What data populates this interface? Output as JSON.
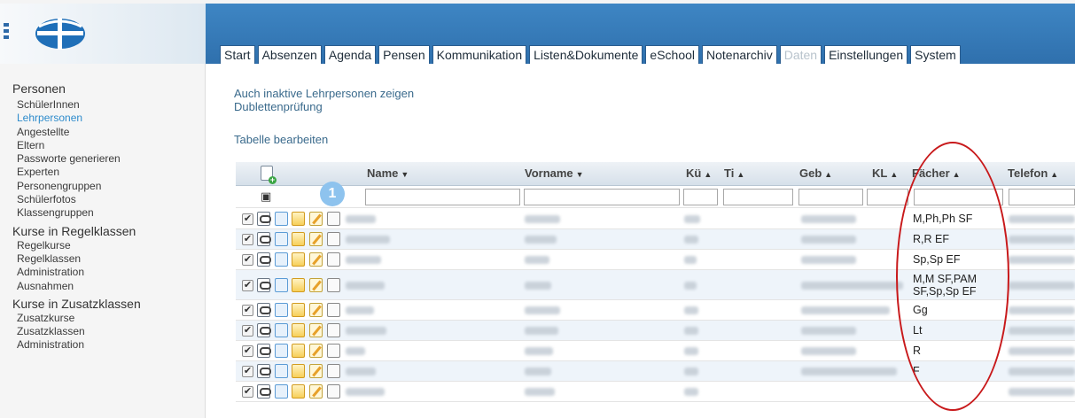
{
  "tabs": [
    {
      "label": "Start",
      "enabled": true
    },
    {
      "label": "Absenzen",
      "enabled": true
    },
    {
      "label": "Agenda",
      "enabled": true
    },
    {
      "label": "Pensen",
      "enabled": true
    },
    {
      "label": "Kommunikation",
      "enabled": true
    },
    {
      "label": "Listen&Dokumente",
      "enabled": true
    },
    {
      "label": "eSchool",
      "enabled": true
    },
    {
      "label": "Notenarchiv",
      "enabled": true
    },
    {
      "label": "Daten",
      "enabled": false
    },
    {
      "label": "Einstellungen",
      "enabled": true
    },
    {
      "label": "System",
      "enabled": true
    }
  ],
  "sidebar": {
    "groups": [
      {
        "title": "Personen",
        "items": [
          "SchülerInnen",
          "Lehrpersonen",
          "Angestellte",
          "Eltern",
          "Passworte generieren",
          "Experten",
          "Personengruppen",
          "Schülerfotos",
          "Klassengruppen"
        ],
        "active": "Lehrpersonen"
      },
      {
        "title": "Kurse in Regelklassen",
        "items": [
          "Regelkurse",
          "Regelklassen",
          "Administration",
          "Ausnahmen"
        ]
      },
      {
        "title": "Kurse in Zusatzklassen",
        "items": [
          "Zusatzkurse",
          "Zusatzklassen",
          "Administration"
        ]
      }
    ]
  },
  "main": {
    "links": {
      "inactive": "Auch inaktive Lehrpersonen zeigen",
      "duplicates": "Dublettenprüfung",
      "edit_table": "Tabelle bearbeiten"
    }
  },
  "table": {
    "columns": {
      "name": "Name",
      "vorname": "Vorname",
      "ku": "Kü",
      "ti": "Ti",
      "geb": "Geb",
      "kl": "KL",
      "faecher": "Fächer",
      "telefon": "Telefon"
    },
    "sort_arrows": {
      "name": "down",
      "vorname": "down",
      "ku": "up",
      "ti": "up",
      "geb": "up",
      "kl": "up",
      "faecher": "up",
      "telefon": "up"
    },
    "rows": [
      {
        "checked": true,
        "faecher": "M,Ph,Ph SF"
      },
      {
        "checked": true,
        "faecher": "R,R EF"
      },
      {
        "checked": true,
        "faecher": "Sp,Sp EF"
      },
      {
        "checked": true,
        "faecher": "M,M SF,PAM\nSF,Sp,Sp EF"
      },
      {
        "checked": true,
        "faecher": "Gg"
      },
      {
        "checked": true,
        "faecher": "Lt"
      },
      {
        "checked": true,
        "faecher": "R"
      },
      {
        "checked": true,
        "faecher": "F"
      }
    ]
  },
  "annotation": {
    "badge": "1"
  },
  "colors": {
    "header_blue": "#2f70ad",
    "active_link": "#2f8ccc",
    "highlight_ellipse": "#c8191b",
    "badge": "#8ec3ee"
  }
}
